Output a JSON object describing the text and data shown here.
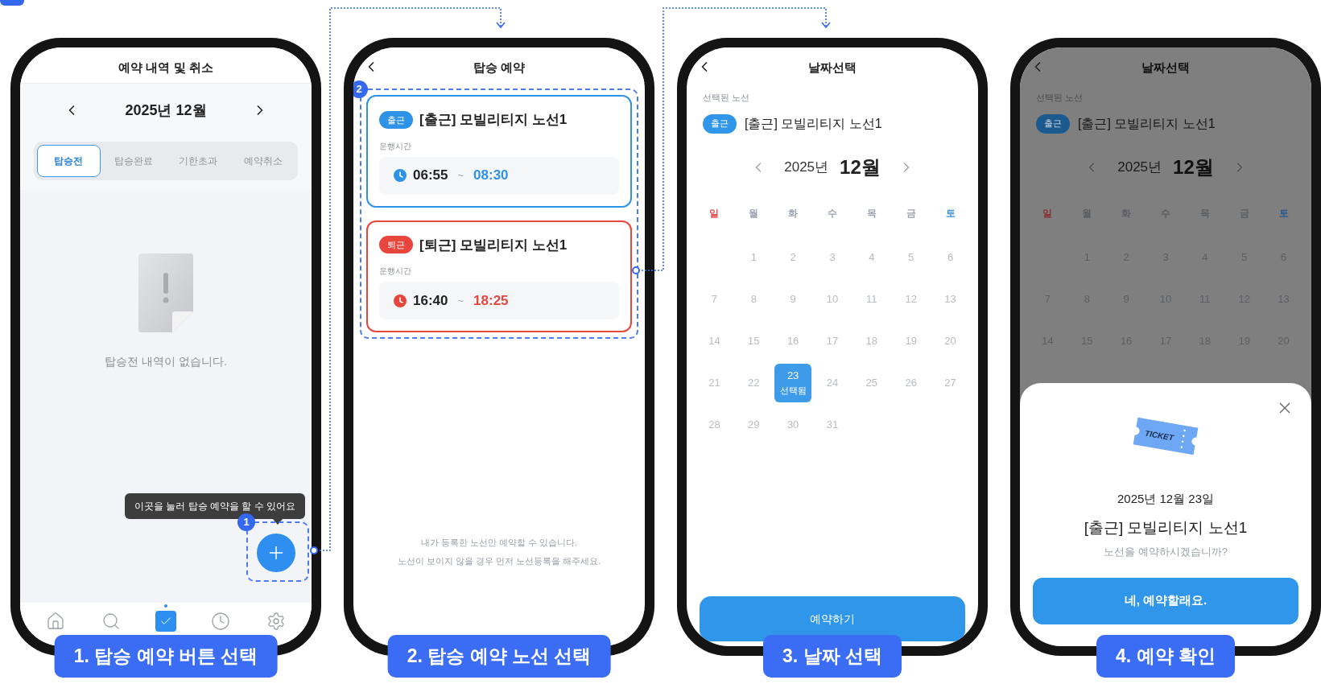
{
  "screens": [
    {
      "kind": "history",
      "title": "예약 내역 및 취소",
      "month": "2025년 12월",
      "tabs": [
        {
          "label": "탑승전",
          "selected": true
        },
        {
          "label": "탑승완료",
          "selected": false
        },
        {
          "label": "기한초과",
          "selected": false
        },
        {
          "label": "예약취소",
          "selected": false
        }
      ],
      "empty_message": "탑승전 내역이 없습니다.",
      "tooltip": "이곳을 눌러 탑승 예약을 할 수 있어요",
      "marker": "1",
      "nav": [
        {
          "kind": "home",
          "selected": false
        },
        {
          "kind": "search",
          "selected": false
        },
        {
          "kind": "reservation",
          "selected": true
        },
        {
          "kind": "history",
          "selected": false
        },
        {
          "kind": "settings",
          "selected": false
        }
      ]
    },
    {
      "kind": "routes",
      "title": "탑승 예약",
      "marker": "2",
      "routes": [
        {
          "tag": "출근",
          "name": "[출근] 모빌리티지 노선1",
          "time_label": "운행시간",
          "start": "06:55",
          "separator": "~",
          "end": "08:30",
          "color": "#2e92e6"
        },
        {
          "tag": "퇴근",
          "name": "[퇴근] 모빌리티지 노선1",
          "time_label": "운행시간",
          "start": "16:40",
          "separator": "~",
          "end": "18:25",
          "color": "#e6463c"
        }
      ],
      "notes": [
        "내가 등록한 노선만 예약할 수 있습니다.",
        "노선이 보이지 않을 경우 먼저 노선등록을 해주세요."
      ]
    },
    {
      "kind": "calendar",
      "title": "날짜선택",
      "selected_label": "선택된 노선",
      "tag": "출근",
      "route": "[출근] 모빌리티지 노선1",
      "year": "2025년",
      "month": "12월",
      "weekdays": [
        {
          "label": "일",
          "color": "#e5484d"
        },
        {
          "label": "월",
          "color": "#9ca3af"
        },
        {
          "label": "화",
          "color": "#9ca3af"
        },
        {
          "label": "수",
          "color": "#9ca3af"
        },
        {
          "label": "목",
          "color": "#9ca3af"
        },
        {
          "label": "금",
          "color": "#9ca3af"
        },
        {
          "label": "토",
          "color": "#3b8fe0"
        }
      ],
      "weeks": [
        [
          {
            "kind": "blank"
          },
          {
            "kind": "day",
            "day": "1",
            "selected": false
          },
          {
            "kind": "day",
            "day": "2",
            "selected": false
          },
          {
            "kind": "day",
            "day": "3",
            "selected": false
          },
          {
            "kind": "day",
            "day": "4",
            "selected": false
          },
          {
            "kind": "day",
            "day": "5",
            "selected": false
          },
          {
            "kind": "day",
            "day": "6",
            "selected": false
          }
        ],
        [
          {
            "kind": "day",
            "day": "7",
            "selected": false
          },
          {
            "kind": "day",
            "day": "8",
            "selected": false
          },
          {
            "kind": "day",
            "day": "9",
            "selected": false
          },
          {
            "kind": "day",
            "day": "10",
            "selected": false
          },
          {
            "kind": "day",
            "day": "11",
            "selected": false
          },
          {
            "kind": "day",
            "day": "12",
            "selected": false
          },
          {
            "kind": "day",
            "day": "13",
            "selected": false
          }
        ],
        [
          {
            "kind": "day",
            "day": "14",
            "selected": false
          },
          {
            "kind": "day",
            "day": "15",
            "selected": false
          },
          {
            "kind": "day",
            "day": "16",
            "selected": false
          },
          {
            "kind": "day",
            "day": "17",
            "selected": false
          },
          {
            "kind": "day",
            "day": "18",
            "selected": false
          },
          {
            "kind": "day",
            "day": "19",
            "selected": false
          },
          {
            "kind": "day",
            "day": "20",
            "selected": false
          }
        ],
        [
          {
            "kind": "day",
            "day": "21",
            "selected": false
          },
          {
            "kind": "day",
            "day": "22",
            "selected": false
          },
          {
            "kind": "day",
            "day": "23",
            "selected": true,
            "note": "선택됨"
          },
          {
            "kind": "day",
            "day": "24",
            "selected": false
          },
          {
            "kind": "day",
            "day": "25",
            "selected": false
          },
          {
            "kind": "day",
            "day": "26",
            "selected": false
          },
          {
            "kind": "day",
            "day": "27",
            "selected": false
          }
        ],
        [
          {
            "kind": "day",
            "day": "28",
            "selected": false
          },
          {
            "kind": "day",
            "day": "29",
            "selected": false
          },
          {
            "kind": "day",
            "day": "30",
            "selected": false
          },
          {
            "kind": "day",
            "day": "31",
            "selected": false
          },
          {
            "kind": "blank"
          },
          {
            "kind": "blank"
          },
          {
            "kind": "blank"
          }
        ]
      ],
      "button": "예약하기"
    },
    {
      "kind": "confirm",
      "title": "날짜선택",
      "selected_label": "선택된 노선",
      "tag": "출근",
      "route": "[출근] 모빌리티지 노선1",
      "year": "2025년",
      "month": "12월",
      "weekdays": [
        {
          "label": "일",
          "color": "#8a3034"
        },
        {
          "label": "월",
          "color": "#5a5d62"
        },
        {
          "label": "화",
          "color": "#5a5d62"
        },
        {
          "label": "수",
          "color": "#5a5d62"
        },
        {
          "label": "목",
          "color": "#5a5d62"
        },
        {
          "label": "금",
          "color": "#5a5d62"
        },
        {
          "label": "토",
          "color": "#235a8c"
        }
      ],
      "weeks": [
        [
          {
            "kind": "blank"
          },
          {
            "kind": "day",
            "day": "1",
            "selected": false
          },
          {
            "kind": "day",
            "day": "2",
            "selected": false
          },
          {
            "kind": "day",
            "day": "3",
            "selected": false
          },
          {
            "kind": "day",
            "day": "4",
            "selected": false
          },
          {
            "kind": "day",
            "day": "5",
            "selected": false
          },
          {
            "kind": "day",
            "day": "6",
            "selected": false
          }
        ],
        [
          {
            "kind": "day",
            "day": "7",
            "selected": false
          },
          {
            "kind": "day",
            "day": "8",
            "selected": false
          },
          {
            "kind": "day",
            "day": "9",
            "selected": false
          },
          {
            "kind": "day",
            "day": "10",
            "selected": false
          },
          {
            "kind": "day",
            "day": "11",
            "selected": false
          },
          {
            "kind": "day",
            "day": "12",
            "selected": false
          },
          {
            "kind": "day",
            "day": "13",
            "selected": false
          }
        ],
        [
          {
            "kind": "day",
            "day": "14",
            "selected": false
          },
          {
            "kind": "day",
            "day": "15",
            "selected": false
          },
          {
            "kind": "day",
            "day": "16",
            "selected": false
          },
          {
            "kind": "day",
            "day": "17",
            "selected": false
          },
          {
            "kind": "day",
            "day": "18",
            "selected": false
          },
          {
            "kind": "day",
            "day": "19",
            "selected": false
          },
          {
            "kind": "day",
            "day": "20",
            "selected": false
          }
        ]
      ],
      "modal": {
        "ticket_label": "TICKET",
        "date": "2025년 12월 23일",
        "route": "[출근] 모빌리티지 노선1",
        "question": "노선을 예약하시겠습니까?",
        "button": "네, 예약할래요."
      }
    }
  ],
  "steps": [
    "1. 탑승 예약 버튼 선택",
    "2. 탑승 예약 노선 선택",
    "3. 날짜 선택",
    "4. 예약 확인"
  ]
}
